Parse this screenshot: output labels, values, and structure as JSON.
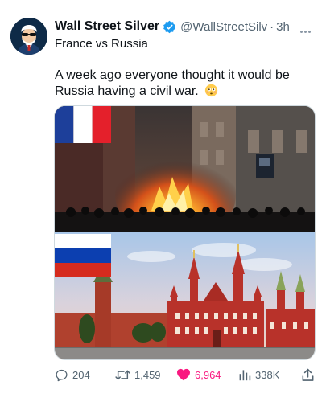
{
  "author": {
    "name": "Wall Street Silver",
    "handle": "@WallStreetSilv",
    "separator": "·",
    "time": "3h",
    "verified": true,
    "avatar_icon": "uncle-sam-sunglasses-avatar"
  },
  "quoted_title": "France vs Russia",
  "tweet_text": "A week ago everyone thought it would be Russia having a civil war.",
  "emoji": "flushed-face-emoji",
  "media": {
    "top_flag": "france-flag",
    "bottom_flag": "russia-flag"
  },
  "actions": {
    "replies": "204",
    "retweets": "1,459",
    "likes": "6,964",
    "views": "338K"
  },
  "colors": {
    "verified": "#1d9bf0",
    "like": "#f91880",
    "muted_text": "#536471"
  }
}
